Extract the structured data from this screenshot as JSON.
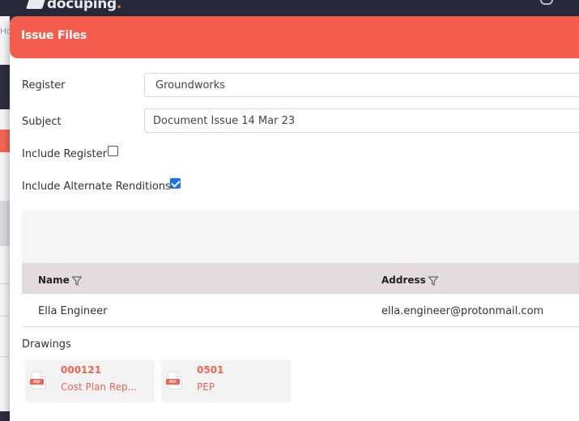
{
  "app": {
    "logo_word": "docuping",
    "logo_dot": "."
  },
  "background": {
    "breadcrumb_fragment": "Ho"
  },
  "modal": {
    "title": "Issue Files",
    "register_label": "Register",
    "register_value": "Groundworks",
    "subject_label": "Subject",
    "subject_value": "Document Issue 14 Mar 23",
    "include_register_label": "Include Register",
    "include_register_checked": false,
    "include_alt_label": "Include Alternate Renditions",
    "include_alt_checked": true
  },
  "grid": {
    "columns": [
      "Name",
      "Address"
    ],
    "rows": [
      {
        "name": "Ella Engineer",
        "address": "ella.engineer@protonmail.com"
      }
    ]
  },
  "drawings": {
    "label": "Drawings",
    "file_type_badge": "PDF",
    "items": [
      {
        "number": "000121",
        "title": "Cost Plan Rep..."
      },
      {
        "number": "0501",
        "title": "PEP"
      }
    ]
  },
  "colors": {
    "accent": "#f45c4d",
    "header_bg": "#262a38",
    "checkbox": "#1a73e8"
  },
  "icons": [
    "docuping-logo-icon",
    "user-icon",
    "filter-icon",
    "pdf-file-icon",
    "checkbox-icon"
  ]
}
